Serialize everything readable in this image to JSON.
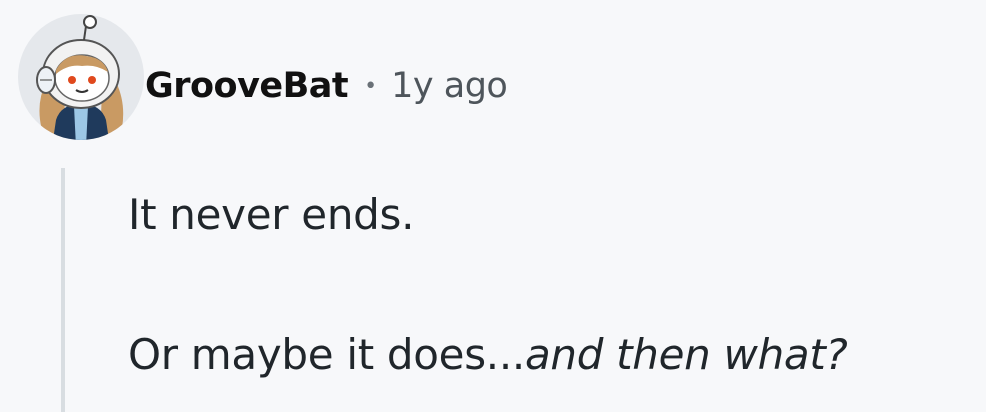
{
  "comment": {
    "author": "GrooveBat",
    "separator": "•",
    "timestamp": "1y ago",
    "avatar_icon": "snoo-avatar-icon",
    "body": {
      "paragraph_1": "It never ends.",
      "paragraph_2_plain": "Or maybe it does...",
      "paragraph_2_italic": "and then what?"
    }
  },
  "colors": {
    "background": "#f7f8fa",
    "thread_line": "#d8dde1",
    "text": "#20262b",
    "meta": "#4e555b"
  }
}
